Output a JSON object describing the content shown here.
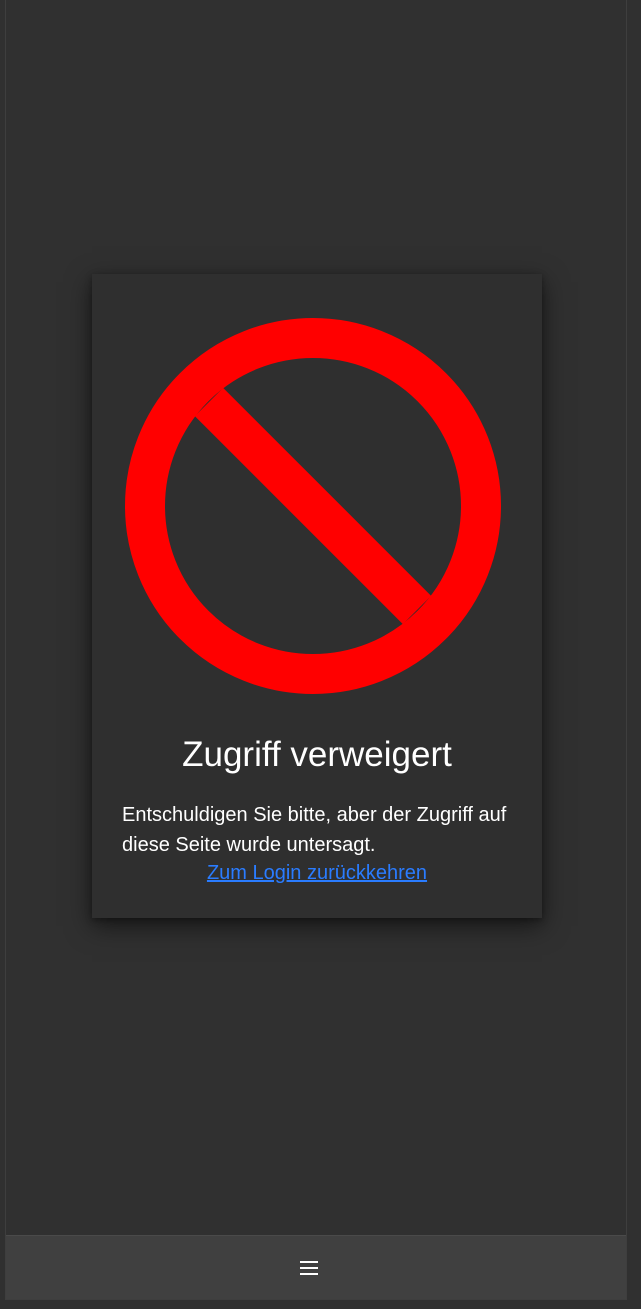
{
  "card": {
    "icon": "forbidden-icon",
    "title": "Zugriff verweigert",
    "message": "Entschuldigen Sie bitte, aber der Zugriff auf diese Seite wurde untersagt.",
    "login_link": "Zum Login zurückkehren"
  },
  "bottom_bar": {
    "menu_icon": "hamburger-menu-icon"
  },
  "colors": {
    "background": "#303030",
    "card_background": "#2f2f2f",
    "forbidden_red": "#ff0000",
    "link_blue": "#2a7cff",
    "bottom_bar_background": "#404040"
  }
}
